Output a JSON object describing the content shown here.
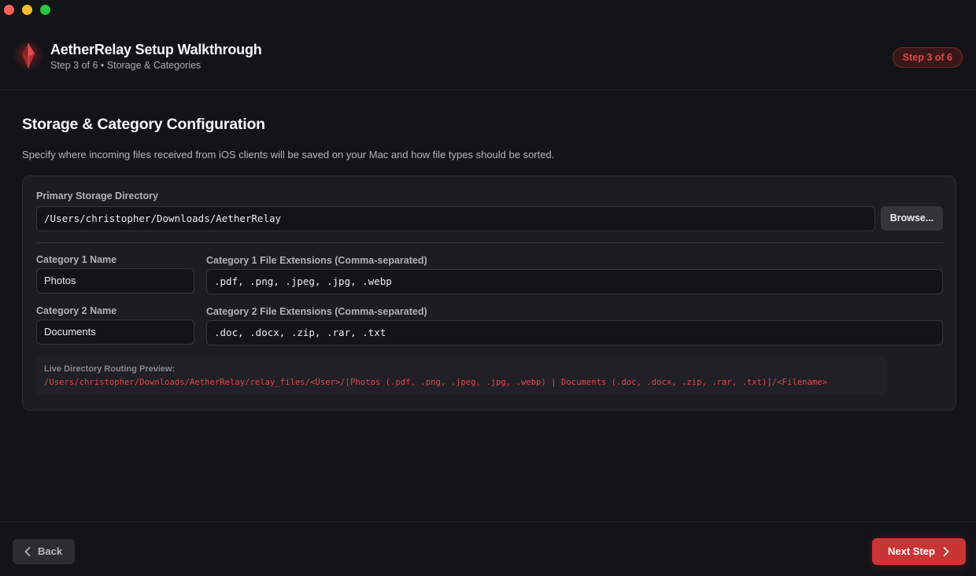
{
  "window": {
    "title": "AetherRelay Setup Walkthrough",
    "subtitle": "Step 3 of 6 • Storage & Categories",
    "step_badge": "Step 3 of 6"
  },
  "section": {
    "title": "Storage & Category Configuration",
    "description": "Specify where incoming files received from iOS clients will be saved on your Mac and how file types should be sorted."
  },
  "storage": {
    "label": "Primary Storage Directory",
    "value": "/Users/christopher/Downloads/AetherRelay",
    "browse_label": "Browse..."
  },
  "categories": [
    {
      "name_label": "Category 1 Name",
      "name_value": "Photos",
      "ext_label": "Category 1 File Extensions (Comma-separated)",
      "ext_value": ".pdf, .png, .jpeg, .jpg, .webp"
    },
    {
      "name_label": "Category 2 Name",
      "name_value": "Documents",
      "ext_label": "Category 2 File Extensions (Comma-separated)",
      "ext_value": ".doc, .docx, .zip, .rar, .txt"
    }
  ],
  "preview": {
    "label": "Live Directory Routing Preview:",
    "path": "/Users/christopher/Downloads/AetherRelay/relay_files/<User>/[Photos (.pdf, .png, .jpeg, .jpg, .webp) | Documents (.doc, .docx, .zip, .rar, .txt)]/<Filename>"
  },
  "footer": {
    "back_label": "Back",
    "next_label": "Next Step"
  },
  "icons": {
    "logo": "crystal-logo-icon",
    "back": "chevron-left-icon",
    "next": "chevron-right-icon"
  },
  "colors": {
    "accent": "#c93434",
    "accent_text": "#e0484a",
    "background": "#141418",
    "card": "#1c1c21"
  }
}
